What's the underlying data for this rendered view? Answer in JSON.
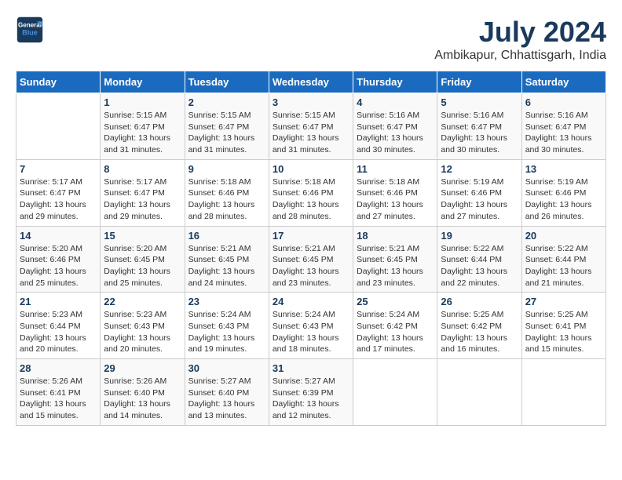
{
  "header": {
    "logo_line1": "General",
    "logo_line2": "Blue",
    "month_year": "July 2024",
    "location": "Ambikapur, Chhattisgarh, India"
  },
  "weekdays": [
    "Sunday",
    "Monday",
    "Tuesday",
    "Wednesday",
    "Thursday",
    "Friday",
    "Saturday"
  ],
  "weeks": [
    [
      {
        "day": "",
        "info": ""
      },
      {
        "day": "1",
        "info": "Sunrise: 5:15 AM\nSunset: 6:47 PM\nDaylight: 13 hours\nand 31 minutes."
      },
      {
        "day": "2",
        "info": "Sunrise: 5:15 AM\nSunset: 6:47 PM\nDaylight: 13 hours\nand 31 minutes."
      },
      {
        "day": "3",
        "info": "Sunrise: 5:15 AM\nSunset: 6:47 PM\nDaylight: 13 hours\nand 31 minutes."
      },
      {
        "day": "4",
        "info": "Sunrise: 5:16 AM\nSunset: 6:47 PM\nDaylight: 13 hours\nand 30 minutes."
      },
      {
        "day": "5",
        "info": "Sunrise: 5:16 AM\nSunset: 6:47 PM\nDaylight: 13 hours\nand 30 minutes."
      },
      {
        "day": "6",
        "info": "Sunrise: 5:16 AM\nSunset: 6:47 PM\nDaylight: 13 hours\nand 30 minutes."
      }
    ],
    [
      {
        "day": "7",
        "info": "Sunrise: 5:17 AM\nSunset: 6:47 PM\nDaylight: 13 hours\nand 29 minutes."
      },
      {
        "day": "8",
        "info": "Sunrise: 5:17 AM\nSunset: 6:47 PM\nDaylight: 13 hours\nand 29 minutes."
      },
      {
        "day": "9",
        "info": "Sunrise: 5:18 AM\nSunset: 6:46 PM\nDaylight: 13 hours\nand 28 minutes."
      },
      {
        "day": "10",
        "info": "Sunrise: 5:18 AM\nSunset: 6:46 PM\nDaylight: 13 hours\nand 28 minutes."
      },
      {
        "day": "11",
        "info": "Sunrise: 5:18 AM\nSunset: 6:46 PM\nDaylight: 13 hours\nand 27 minutes."
      },
      {
        "day": "12",
        "info": "Sunrise: 5:19 AM\nSunset: 6:46 PM\nDaylight: 13 hours\nand 27 minutes."
      },
      {
        "day": "13",
        "info": "Sunrise: 5:19 AM\nSunset: 6:46 PM\nDaylight: 13 hours\nand 26 minutes."
      }
    ],
    [
      {
        "day": "14",
        "info": "Sunrise: 5:20 AM\nSunset: 6:46 PM\nDaylight: 13 hours\nand 25 minutes."
      },
      {
        "day": "15",
        "info": "Sunrise: 5:20 AM\nSunset: 6:45 PM\nDaylight: 13 hours\nand 25 minutes."
      },
      {
        "day": "16",
        "info": "Sunrise: 5:21 AM\nSunset: 6:45 PM\nDaylight: 13 hours\nand 24 minutes."
      },
      {
        "day": "17",
        "info": "Sunrise: 5:21 AM\nSunset: 6:45 PM\nDaylight: 13 hours\nand 23 minutes."
      },
      {
        "day": "18",
        "info": "Sunrise: 5:21 AM\nSunset: 6:45 PM\nDaylight: 13 hours\nand 23 minutes."
      },
      {
        "day": "19",
        "info": "Sunrise: 5:22 AM\nSunset: 6:44 PM\nDaylight: 13 hours\nand 22 minutes."
      },
      {
        "day": "20",
        "info": "Sunrise: 5:22 AM\nSunset: 6:44 PM\nDaylight: 13 hours\nand 21 minutes."
      }
    ],
    [
      {
        "day": "21",
        "info": "Sunrise: 5:23 AM\nSunset: 6:44 PM\nDaylight: 13 hours\nand 20 minutes."
      },
      {
        "day": "22",
        "info": "Sunrise: 5:23 AM\nSunset: 6:43 PM\nDaylight: 13 hours\nand 20 minutes."
      },
      {
        "day": "23",
        "info": "Sunrise: 5:24 AM\nSunset: 6:43 PM\nDaylight: 13 hours\nand 19 minutes."
      },
      {
        "day": "24",
        "info": "Sunrise: 5:24 AM\nSunset: 6:43 PM\nDaylight: 13 hours\nand 18 minutes."
      },
      {
        "day": "25",
        "info": "Sunrise: 5:24 AM\nSunset: 6:42 PM\nDaylight: 13 hours\nand 17 minutes."
      },
      {
        "day": "26",
        "info": "Sunrise: 5:25 AM\nSunset: 6:42 PM\nDaylight: 13 hours\nand 16 minutes."
      },
      {
        "day": "27",
        "info": "Sunrise: 5:25 AM\nSunset: 6:41 PM\nDaylight: 13 hours\nand 15 minutes."
      }
    ],
    [
      {
        "day": "28",
        "info": "Sunrise: 5:26 AM\nSunset: 6:41 PM\nDaylight: 13 hours\nand 15 minutes."
      },
      {
        "day": "29",
        "info": "Sunrise: 5:26 AM\nSunset: 6:40 PM\nDaylight: 13 hours\nand 14 minutes."
      },
      {
        "day": "30",
        "info": "Sunrise: 5:27 AM\nSunset: 6:40 PM\nDaylight: 13 hours\nand 13 minutes."
      },
      {
        "day": "31",
        "info": "Sunrise: 5:27 AM\nSunset: 6:39 PM\nDaylight: 13 hours\nand 12 minutes."
      },
      {
        "day": "",
        "info": ""
      },
      {
        "day": "",
        "info": ""
      },
      {
        "day": "",
        "info": ""
      }
    ]
  ]
}
